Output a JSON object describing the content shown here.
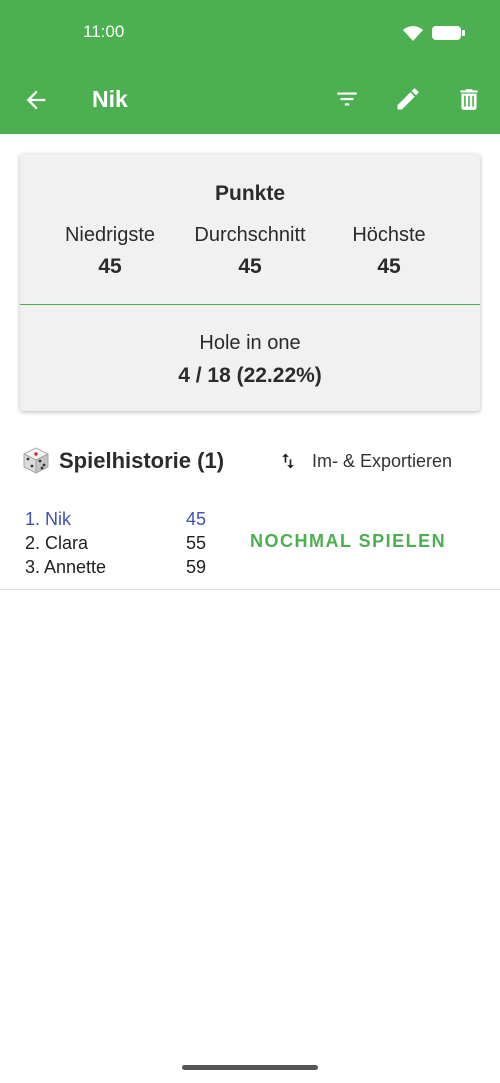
{
  "status_bar": {
    "time": "11:00"
  },
  "app_bar": {
    "title": "Nik",
    "back_icon": "arrow-left-icon",
    "actions": [
      "filter-icon",
      "edit-icon",
      "delete-icon"
    ],
    "color": "#4caf50"
  },
  "stats_card": {
    "title": "Punkte",
    "lowest": {
      "label": "Niedrigste",
      "value": "45"
    },
    "average": {
      "label": "Durchschnitt",
      "value": "45"
    },
    "highest": {
      "label": "Höchste",
      "value": "45"
    },
    "hole_in_one": {
      "label": "Hole in one",
      "value": "4 / 18 (22.22%)"
    }
  },
  "history": {
    "title": "Spielhistorie (1)",
    "export_label": "Im- & Exportieren",
    "games": [
      {
        "players": [
          {
            "rank_name": "1. Nik",
            "score": "45",
            "highlight": true
          },
          {
            "rank_name": "2. Clara",
            "score": "55",
            "highlight": false
          },
          {
            "rank_name": "3. Annette",
            "score": "59",
            "highlight": false
          }
        ],
        "replay_label": "NOCHMAL SPIELEN"
      }
    ]
  },
  "colors": {
    "accent": "#4caf50",
    "highlight": "#3f51b5"
  }
}
